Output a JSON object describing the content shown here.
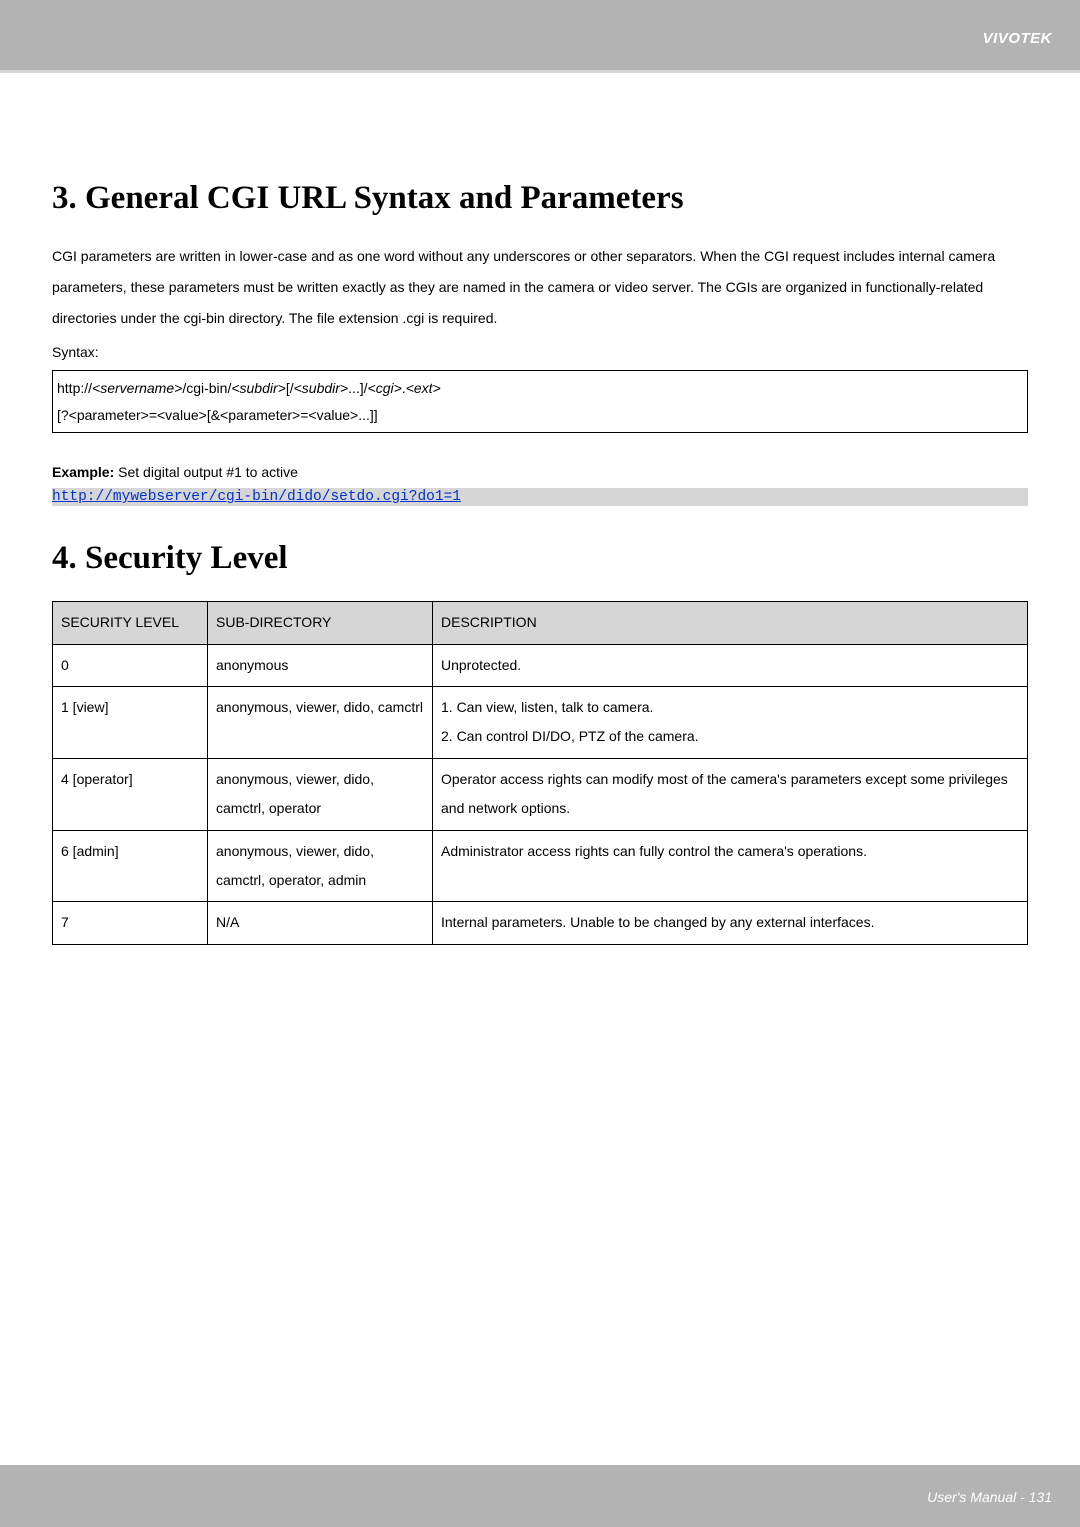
{
  "brand": "VIVOTEK",
  "footer": "User's Manual - 131",
  "section3": {
    "title": "3. General CGI URL Syntax and Parameters",
    "paragraph": "CGI parameters are written in lower-case and as one word without any underscores or other separators. When the CGI request includes internal camera parameters, these parameters must be written exactly as they are named in the camera or video server. The CGIs are organized in functionally-related directories under the cgi-bin directory. The file extension .cgi is required.",
    "syntax_label": "Syntax:",
    "syntax_line1_plain1": "http://",
    "syntax_line1_ital1": "<servername>",
    "syntax_line1_plain2": "/cgi-bin/",
    "syntax_line1_ital2": "<subdir>",
    "syntax_line1_plain3": "[/",
    "syntax_line1_ital3": "<subdir>",
    "syntax_line1_plain4": "...]/",
    "syntax_line1_ital4": "<cgi>",
    "syntax_line1_plain5": ".",
    "syntax_line1_ital5": "<ext>",
    "syntax_line2": "[?<parameter>=<value>[&<parameter>=<value>...]]",
    "example_label_bold": "Example:",
    "example_label_rest": " Set digital output #1 to active",
    "example_url": "http://mywebserver/cgi-bin/dido/setdo.cgi?do1=1"
  },
  "section4": {
    "title": "4. Security Level",
    "headers": {
      "level": "SECURITY LEVEL",
      "subdir": "SUB-DIRECTORY",
      "desc": "DESCRIPTION"
    },
    "rows": [
      {
        "level": "0",
        "subdir": "anonymous",
        "desc": "Unprotected."
      },
      {
        "level": "1 [view]",
        "subdir": "anonymous, viewer, dido, camctrl",
        "desc": "1. Can view, listen, talk to camera.\n2. Can control DI/DO, PTZ of the camera."
      },
      {
        "level": "4 [operator]",
        "subdir": "anonymous, viewer, dido, camctrl, operator",
        "desc": "Operator access rights can modify most of the camera's parameters except some privileges and network options."
      },
      {
        "level": "6 [admin]",
        "subdir": "anonymous, viewer, dido, camctrl, operator, admin",
        "desc": "Administrator access rights can fully control the camera's operations."
      },
      {
        "level": "7",
        "subdir": "N/A",
        "desc": "Internal parameters. Unable to be changed by any external interfaces."
      }
    ]
  }
}
